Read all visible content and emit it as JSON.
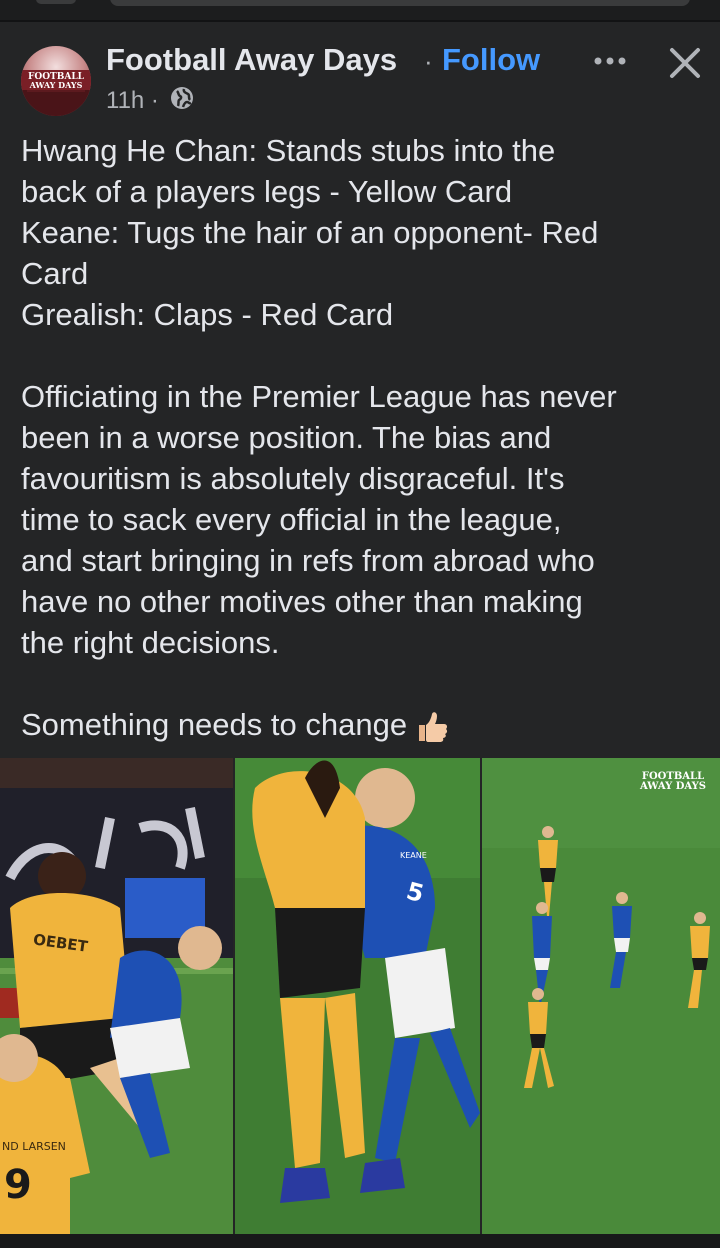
{
  "post": {
    "page_name": "Football Away Days",
    "separator": "·",
    "follow_label": "Follow",
    "time": "11h ·",
    "audience_icon": "globe-icon",
    "more_icon": "more-horizontal-icon",
    "close_icon": "close-icon",
    "avatar_text_1": "FOOTBALL",
    "avatar_text_2": "AWAY DAYS",
    "lines": [
      "Hwang He Chan: Stands stubs into the",
      "back of a players legs - Yellow Card",
      "Keane: Tugs the hair of an opponent- Red",
      "Card",
      "Grealish: Claps - Red Card",
      "",
      "Officiating in the Premier League has never",
      "been in a worse position. The bias and",
      "favouritism is absolutely disgraceful. It's",
      "time to sack every official in the league,",
      "and start bringing in refs from abroad who",
      "have no other motives other than making",
      "the right decisions.",
      "",
      "Something needs to change"
    ],
    "emoji_icon": "thumbs-up-icon",
    "media": {
      "photo_1_text": "OEBET",
      "photo_1_name": "ND LARSEN",
      "photo_1_number": "9",
      "photo_2_number": "5",
      "photo_2_name": "KEANE",
      "watermark_1": "FOOTBALL",
      "watermark_2": "AWAY DAYS"
    }
  },
  "colors": {
    "background": "#242526",
    "text": "#e4e6eb",
    "secondary_text": "#b0b3b8",
    "follow": "#4599ff",
    "wolves_gold": "#f0b43c",
    "everton_blue": "#1e50b4",
    "pitch": "#4a8a3a"
  }
}
